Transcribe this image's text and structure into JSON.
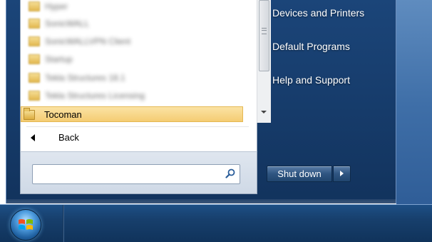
{
  "start_menu": {
    "programs": [
      {
        "label": "Hyper"
      },
      {
        "label": "SonicWALL"
      },
      {
        "label": "SonicWALLVPN Client"
      },
      {
        "label": "Startup"
      },
      {
        "label": "Tekla Structures 18.1"
      },
      {
        "label": "Tekla Structures Licensing"
      }
    ],
    "selected_program": "Tocoman",
    "back_label": "Back",
    "search": {
      "value": "",
      "placeholder": ""
    },
    "right_links": {
      "devices": "Devices and Printers",
      "default_programs": "Default Programs",
      "help": "Help and Support"
    },
    "shutdown_label": "Shut down"
  },
  "icons": {
    "folder": "folder-icon",
    "search": "search-icon",
    "back": "back-arrow-icon",
    "shutdown_options": "chevron-right-icon",
    "start": "windows-logo-icon"
  },
  "colors": {
    "selected_bg": "#f4cc73",
    "menu_blue": "#173d6d",
    "taskbar": "#173f6c"
  }
}
